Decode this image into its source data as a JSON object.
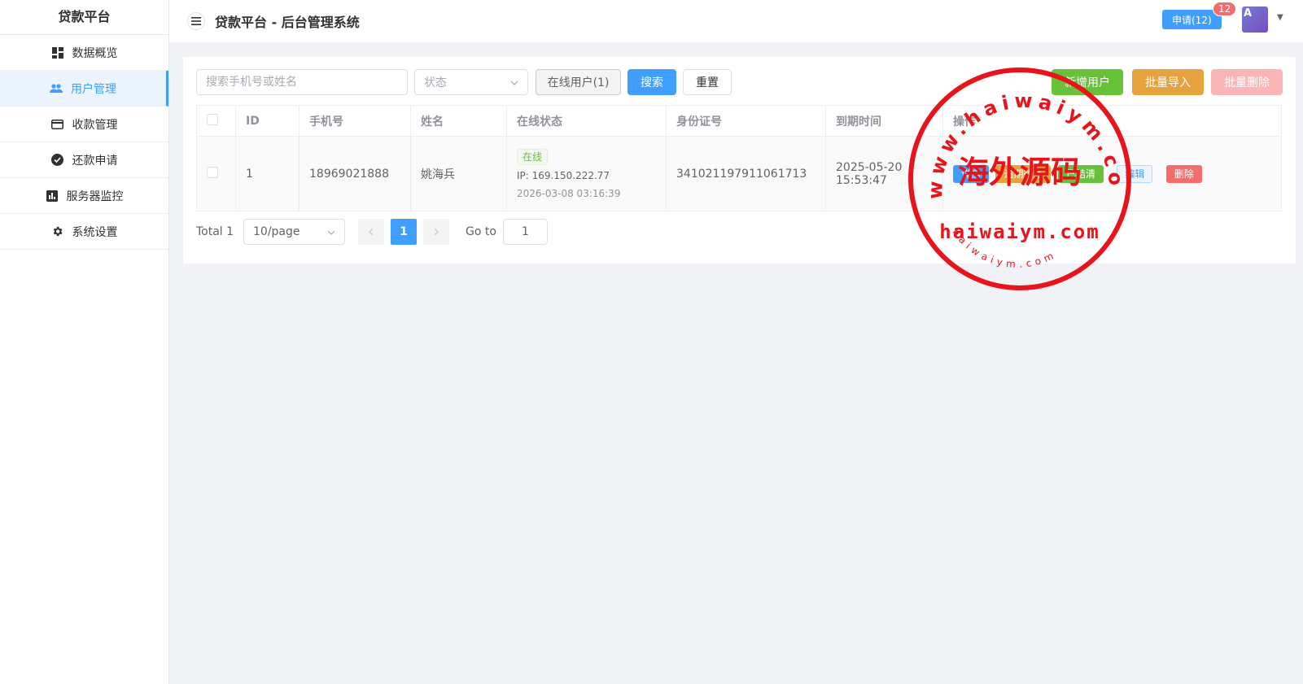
{
  "sidebar": {
    "brand": "贷款平台",
    "items": [
      {
        "label": "数据概览",
        "icon": "dashboard-icon"
      },
      {
        "label": "用户管理",
        "icon": "users-icon",
        "active": true
      },
      {
        "label": "收款管理",
        "icon": "credit-card-icon"
      },
      {
        "label": "还款申请",
        "icon": "check-circle-icon"
      },
      {
        "label": "服务器监控",
        "icon": "bar-chart-icon"
      },
      {
        "label": "系统设置",
        "icon": "gear-icon"
      }
    ]
  },
  "header": {
    "title": "贷款平台 - 后台管理系统",
    "apply_label": "申请(12)",
    "apply_badge": "12",
    "avatar_letter": "A"
  },
  "toolbar": {
    "search_placeholder": "搜索手机号或姓名",
    "status_placeholder": "状态",
    "online_label": "在线用户(1)",
    "search_label": "搜索",
    "reset_label": "重置",
    "add_label": "新增用户",
    "import_label": "批量导入",
    "batch_delete_label": "批量删除"
  },
  "table": {
    "headers": [
      "ID",
      "手机号",
      "姓名",
      "在线状态",
      "身份证号",
      "到期时间",
      "操作"
    ],
    "rows": [
      {
        "id": "1",
        "phone": "18969021888",
        "name": "姚海兵",
        "online_tag": "在线",
        "ip": "IP: 169.150.222.77",
        "last_seen": "2026-03-08 03:16:39",
        "id_card": "341021197911061713",
        "expire": "2025-05-20 15:53:47",
        "ops": {
          "detail": "详情",
          "overdue": "逾期待还",
          "settled": "已结清",
          "edit": "编辑",
          "delete": "删除"
        }
      }
    ]
  },
  "pagination": {
    "total": "Total 1",
    "page_size": "10/page",
    "current_page": "1",
    "goto_label": "Go to",
    "goto_value": "1"
  },
  "watermark": {
    "arc_text": "www.haiwaiym.com",
    "center_text": "海外源码",
    "domain_text": "haiwaiym.com",
    "bottom_text": "haiwaiym.com",
    "color": "#e8141b"
  },
  "colors": {
    "primary": "#409eff",
    "success": "#67c23a",
    "warning": "#e6a23c",
    "danger": "#f56c6c"
  }
}
